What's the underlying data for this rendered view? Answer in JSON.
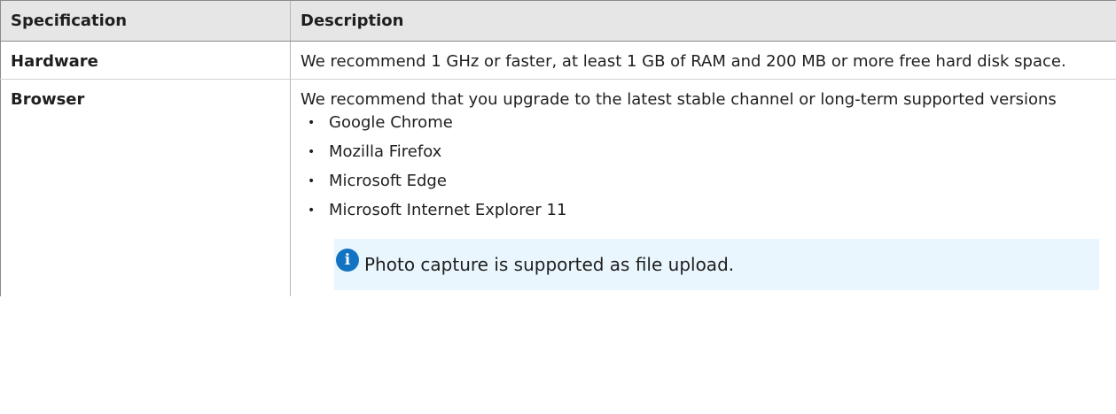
{
  "table": {
    "headers": {
      "specification": "Specification",
      "description": "Description"
    },
    "rows": [
      {
        "spec": "Hardware",
        "description": "We recommend 1 GHz or faster, at least 1 GB of RAM and 200 MB or more free hard disk space."
      },
      {
        "spec": "Browser",
        "description": "We recommend that you upgrade to the latest stable channel or long-term supported versions",
        "bullet_glyph": "•",
        "items": [
          "Google Chrome",
          "Mozilla Firefox",
          "Microsoft Edge",
          "Microsoft Internet Explorer 11"
        ],
        "note": {
          "icon": "info-icon",
          "icon_glyph": "i",
          "text": "Photo capture is supported as file upload.",
          "color": "#1273c2",
          "background": "#e9f6fd"
        }
      }
    ]
  }
}
